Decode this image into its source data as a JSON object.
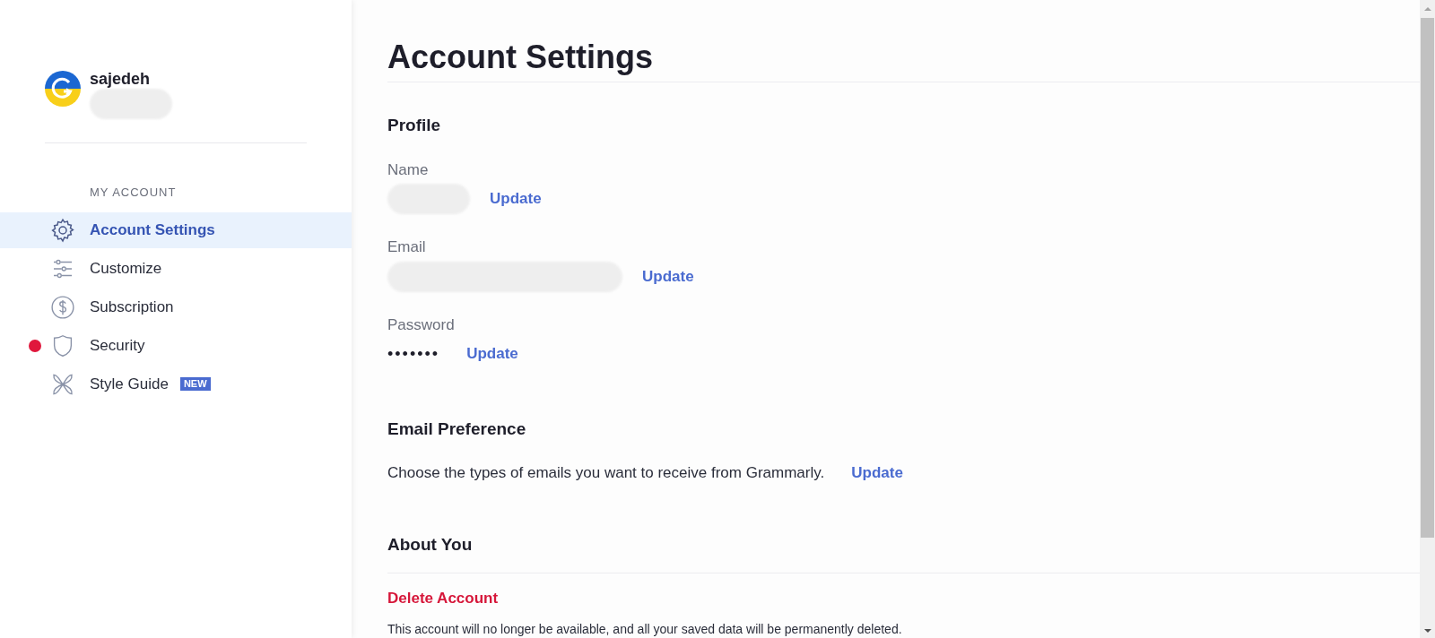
{
  "sidebar": {
    "user": {
      "name": "sajedeh"
    },
    "section_label": "MY ACCOUNT",
    "items": [
      {
        "label": "Account Settings",
        "selected": true,
        "alert": false
      },
      {
        "label": "Customize",
        "selected": false,
        "alert": false
      },
      {
        "label": "Subscription",
        "selected": false,
        "alert": false
      },
      {
        "label": "Security",
        "selected": false,
        "alert": true
      },
      {
        "label": "Style Guide",
        "selected": false,
        "alert": false,
        "badge": "NEW"
      }
    ]
  },
  "main": {
    "title": "Account Settings",
    "profile": {
      "heading": "Profile",
      "fields": [
        {
          "label": "Name",
          "kind": "redacted_short",
          "action": "Update"
        },
        {
          "label": "Email",
          "kind": "redacted_long",
          "action": "Update"
        },
        {
          "label": "Password",
          "kind": "text",
          "value": "•••••••",
          "action": "Update"
        }
      ]
    },
    "email_preference": {
      "heading": "Email Preference",
      "text": "Choose the types of emails you want to receive from Grammarly.",
      "action": "Update"
    },
    "about": {
      "heading": "About You"
    },
    "delete": {
      "title": "Delete Account",
      "text": "This account will no longer be available, and all your saved data will be permanently deleted."
    }
  }
}
